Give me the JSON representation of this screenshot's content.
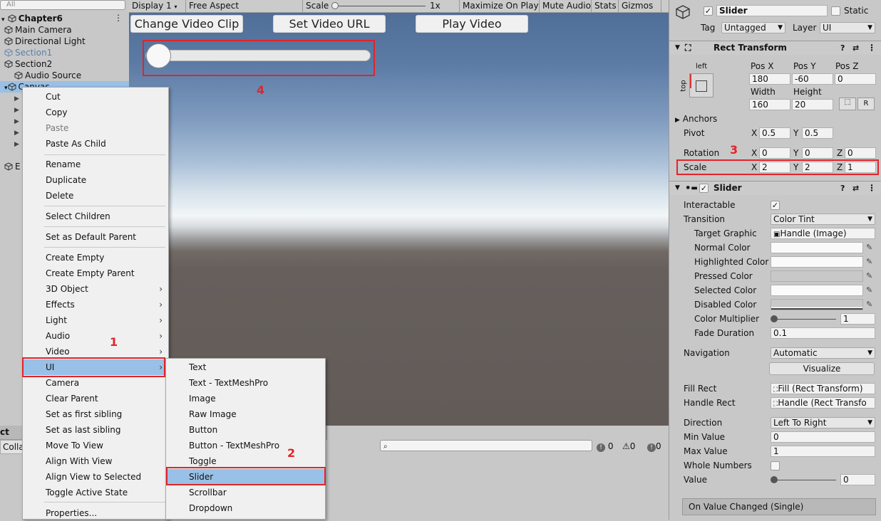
{
  "hierarchy": {
    "search_placeholder": "All",
    "items": [
      {
        "label": "Chapter6",
        "bold": true
      },
      {
        "label": "Main Camera"
      },
      {
        "label": "Directional Light"
      },
      {
        "label": "Section1",
        "faded": true
      },
      {
        "label": "Section2"
      },
      {
        "label": "Audio Source"
      },
      {
        "label": "Canvas",
        "selected": true
      },
      {
        "label": "E"
      }
    ]
  },
  "game_toolbar": {
    "display": "Display 1",
    "aspect": "Free Aspect",
    "scale_label": "Scale",
    "scale_value": "1x",
    "maximize": "Maximize On Play",
    "mute": "Mute Audio",
    "stats": "Stats",
    "gizmos": "Gizmos"
  },
  "game_view": {
    "buttons": [
      "Change Video Clip",
      "Set Video URL",
      "Play Video"
    ],
    "slider_value": 0
  },
  "context_menu": {
    "items": [
      "Cut",
      "Copy",
      "Paste",
      "Paste As Child",
      "Rename",
      "Duplicate",
      "Delete",
      "Select Children",
      "Set as Default Parent",
      "Create Empty",
      "Create Empty Parent",
      "3D Object",
      "Effects",
      "Light",
      "Audio",
      "Video",
      "UI",
      "Camera",
      "Clear Parent",
      "Set as first sibling",
      "Set as last sibling",
      "Move To View",
      "Align With View",
      "Align View to Selected",
      "Toggle Active State",
      "Properties..."
    ],
    "disabled": [
      "Paste"
    ],
    "highlighted": "UI"
  },
  "ui_submenu": {
    "items": [
      "Text",
      "Text - TextMeshPro",
      "Image",
      "Raw Image",
      "Button",
      "Button - TextMeshPro",
      "Toggle",
      "Slider",
      "Scrollbar",
      "Dropdown"
    ],
    "highlighted": "Slider"
  },
  "annotations": [
    "1",
    "2",
    "3",
    "4"
  ],
  "console": {
    "tab": "ct",
    "collapse": "Colla",
    "search_placeholder": "",
    "counts": [
      "0",
      "0",
      "0"
    ]
  },
  "inspector": {
    "object_name": "Slider",
    "static_label": "Static",
    "tag_label": "Tag",
    "tag_value": "Untagged",
    "layer_label": "Layer",
    "layer_value": "UI",
    "rect_transform": {
      "title": "Rect Transform",
      "anchor_h": "left",
      "anchor_v": "top",
      "posx_label": "Pos X",
      "posy_label": "Pos Y",
      "posz_label": "Pos Z",
      "posx": "180",
      "posy": "-60",
      "posz": "0",
      "width_label": "Width",
      "height_label": "Height",
      "width": "160",
      "height": "20",
      "r_button": "R",
      "anchors_label": "Anchors",
      "pivot_label": "Pivot",
      "pivot_x": "0.5",
      "pivot_y": "0.5",
      "rotation_label": "Rotation",
      "rot_x": "0",
      "rot_y": "0",
      "rot_z": "0",
      "scale_label": "Scale",
      "scale_x": "2",
      "scale_y": "2",
      "scale_z": "1",
      "x": "X",
      "y": "Y",
      "z": "Z"
    },
    "slider": {
      "title": "Slider",
      "interactable_label": "Interactable",
      "transition_label": "Transition",
      "transition_value": "Color Tint",
      "target_graphic_label": "Target Graphic",
      "target_graphic_value": "Handle (Image)",
      "normal_color_label": "Normal Color",
      "highlighted_color_label": "Highlighted Color",
      "pressed_color_label": "Pressed Color",
      "selected_color_label": "Selected Color",
      "disabled_color_label": "Disabled Color",
      "color_multiplier_label": "Color Multiplier",
      "color_multiplier_value": "1",
      "fade_duration_label": "Fade Duration",
      "fade_duration_value": "0.1",
      "navigation_label": "Navigation",
      "navigation_value": "Automatic",
      "visualize_label": "Visualize",
      "fill_rect_label": "Fill Rect",
      "fill_rect_value": "Fill (Rect Transform)",
      "handle_rect_label": "Handle Rect",
      "handle_rect_value": "Handle (Rect Transfo",
      "direction_label": "Direction",
      "direction_value": "Left To Right",
      "min_value_label": "Min Value",
      "min_value": "0",
      "max_value_label": "Max Value",
      "max_value": "1",
      "whole_numbers_label": "Whole Numbers",
      "value_label": "Value",
      "value": "0",
      "on_value_changed": "On Value Changed (Single)"
    }
  },
  "colors": {
    "highlight": "#99c0e6",
    "annotation": "#e1242a"
  }
}
